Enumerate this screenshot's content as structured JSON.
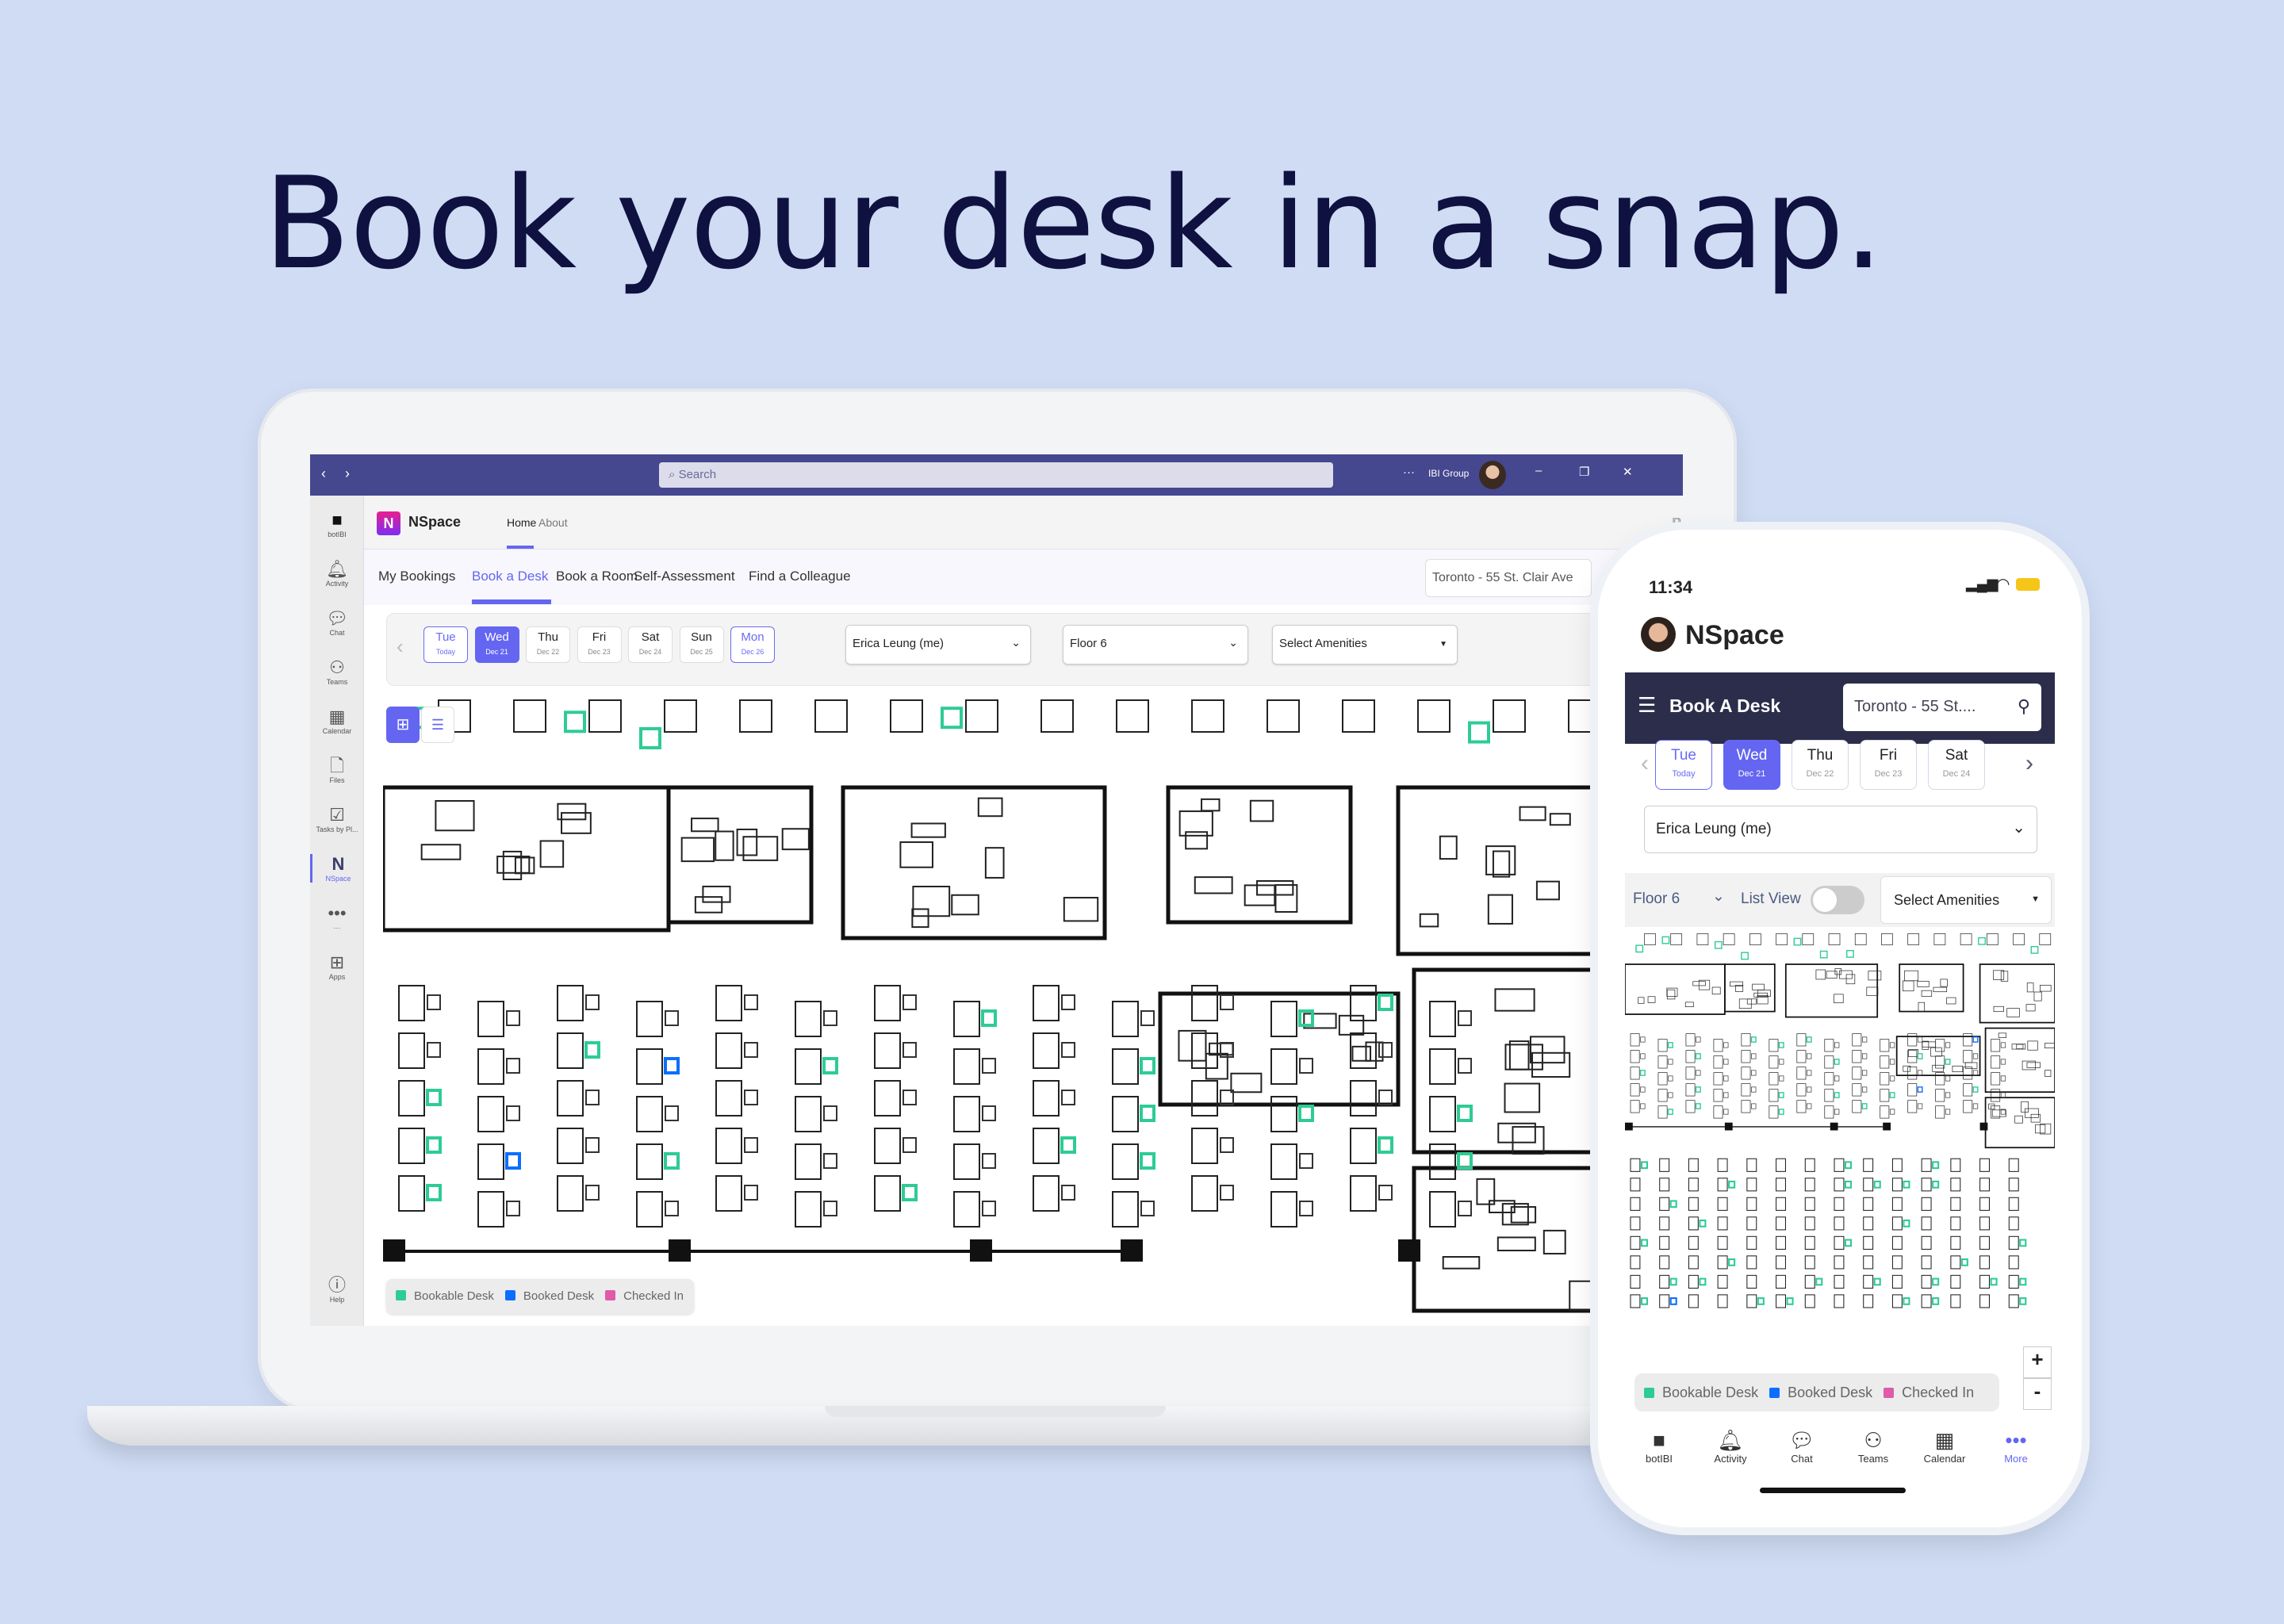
{
  "headline": "Book your desk in a snap.",
  "desktop": {
    "search_placeholder": "Search",
    "more": "···",
    "org": "IBI Group",
    "rail": [
      {
        "label": "botIBI",
        "icon": "bot-icon"
      },
      {
        "label": "Activity",
        "icon": "bell-icon"
      },
      {
        "label": "Chat",
        "icon": "chat-icon"
      },
      {
        "label": "Teams",
        "icon": "teams-icon"
      },
      {
        "label": "Calendar",
        "icon": "calendar-icon"
      },
      {
        "label": "Files",
        "icon": "file-icon"
      },
      {
        "label": "Tasks by Pl...",
        "icon": "tasks-icon"
      },
      {
        "label": "NSpace",
        "icon": "nspace-icon",
        "active": true
      },
      {
        "label": "···",
        "icon": "more-icon"
      },
      {
        "label": "Apps",
        "icon": "apps-icon"
      }
    ],
    "help": "Help",
    "app_name": "NSpace",
    "app_tabs": [
      "Home",
      "About"
    ],
    "nav": [
      "My Bookings",
      "Book a Desk",
      "Book a Room",
      "Self-Assessment",
      "Find a Colleague"
    ],
    "location": "Toronto - 55 St. Clair Ave",
    "days": [
      {
        "d": "Tue",
        "s": "Today",
        "state": "today"
      },
      {
        "d": "Wed",
        "s": "Dec 21",
        "state": "selected"
      },
      {
        "d": "Thu",
        "s": "Dec 22"
      },
      {
        "d": "Fri",
        "s": "Dec 23"
      },
      {
        "d": "Sat",
        "s": "Dec 24"
      },
      {
        "d": "Sun",
        "s": "Dec 25"
      },
      {
        "d": "Mon",
        "s": "Dec 26",
        "state": "today"
      }
    ],
    "person": "Erica Leung (me)",
    "floor": "Floor 6",
    "amenities": "Select Amenities"
  },
  "legend": [
    {
      "label": "Bookable Desk",
      "color": "#2ecc94"
    },
    {
      "label": "Booked Desk",
      "color": "#0d6efd"
    },
    {
      "label": "Checked In",
      "color": "#e05aaa"
    }
  ],
  "colors": {
    "teams_bar": "#45478f",
    "accent": "#6466f1",
    "phone_bar": "#2b2d4a"
  },
  "phone": {
    "time": "11:34",
    "app_name": "NSpace",
    "title": "Book A Desk",
    "location": "Toronto - 55 St....",
    "days": [
      {
        "d": "Tue",
        "s": "Today",
        "state": "today"
      },
      {
        "d": "Wed",
        "s": "Dec 21",
        "state": "selected"
      },
      {
        "d": "Thu",
        "s": "Dec 22"
      },
      {
        "d": "Fri",
        "s": "Dec 23"
      },
      {
        "d": "Sat",
        "s": "Dec 24"
      }
    ],
    "person": "Erica Leung (me)",
    "floor": "Floor 6",
    "list_view": "List View",
    "list_view_on": false,
    "amenities": "Select Amenities",
    "zoom_in": "+",
    "zoom_out": "-",
    "tabs": [
      {
        "label": "botIBI",
        "icon": "bot-icon"
      },
      {
        "label": "Activity",
        "icon": "bell-icon"
      },
      {
        "label": "Chat",
        "icon": "chat-icon"
      },
      {
        "label": "Teams",
        "icon": "teams-icon"
      },
      {
        "label": "Calendar",
        "icon": "calendar-icon"
      },
      {
        "label": "More",
        "icon": "more-icon",
        "active": true
      }
    ]
  }
}
